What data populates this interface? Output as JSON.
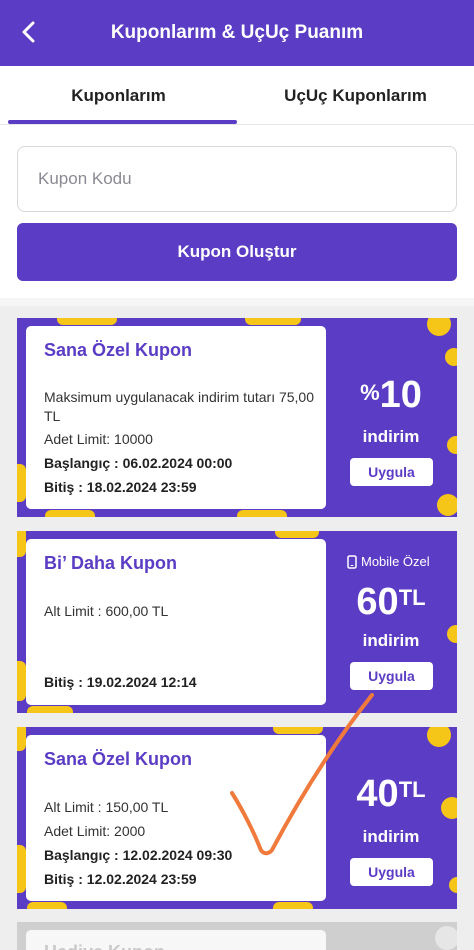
{
  "header": {
    "title": "Kuponlarım & UçUç Puanım",
    "back_icon": "chevron-left-icon"
  },
  "tabs": [
    {
      "label": "Kuponlarım",
      "active": true
    },
    {
      "label": "UçUç Kuponlarım",
      "active": false
    }
  ],
  "form": {
    "code_placeholder": "Kupon Kodu",
    "create_label": "Kupon Oluştur"
  },
  "colors": {
    "brand_purple": "#5b3cc4",
    "accent_yellow": "#f5c518",
    "annotation_orange": "#f07a3c"
  },
  "coupons": [
    {
      "title": "Sana Özel Kupon",
      "lines": [
        "Maksimum uygulanacak indirim tutarı 75,00 TL",
        "Adet Limit: 10000",
        "Başlangıç : 06.02.2024 00:00",
        "Bitiş : 18.02.2024 23:59"
      ],
      "amount_prefix": "%",
      "amount": "10",
      "amount_suffix": "",
      "indirim": "indirim",
      "apply": "Uygula"
    },
    {
      "title": "Bi’ Daha Kupon",
      "badge": "Mobile Özel",
      "lines": [
        "Alt Limit : 600,00 TL",
        "Bitiş : 19.02.2024 12:14"
      ],
      "amount": "60",
      "amount_suffix": "TL",
      "indirim": "indirim",
      "apply": "Uygula"
    },
    {
      "title": "Sana Özel Kupon",
      "lines": [
        "Alt Limit : 150,00 TL",
        "Adet Limit: 2000",
        "Başlangıç : 12.02.2024 09:30",
        "Bitiş : 12.02.2024 23:59"
      ],
      "amount": "40",
      "amount_suffix": "TL",
      "indirim": "indirim",
      "apply": "Uygula"
    },
    {
      "title": "Hediye Kupon",
      "partial": true
    }
  ]
}
